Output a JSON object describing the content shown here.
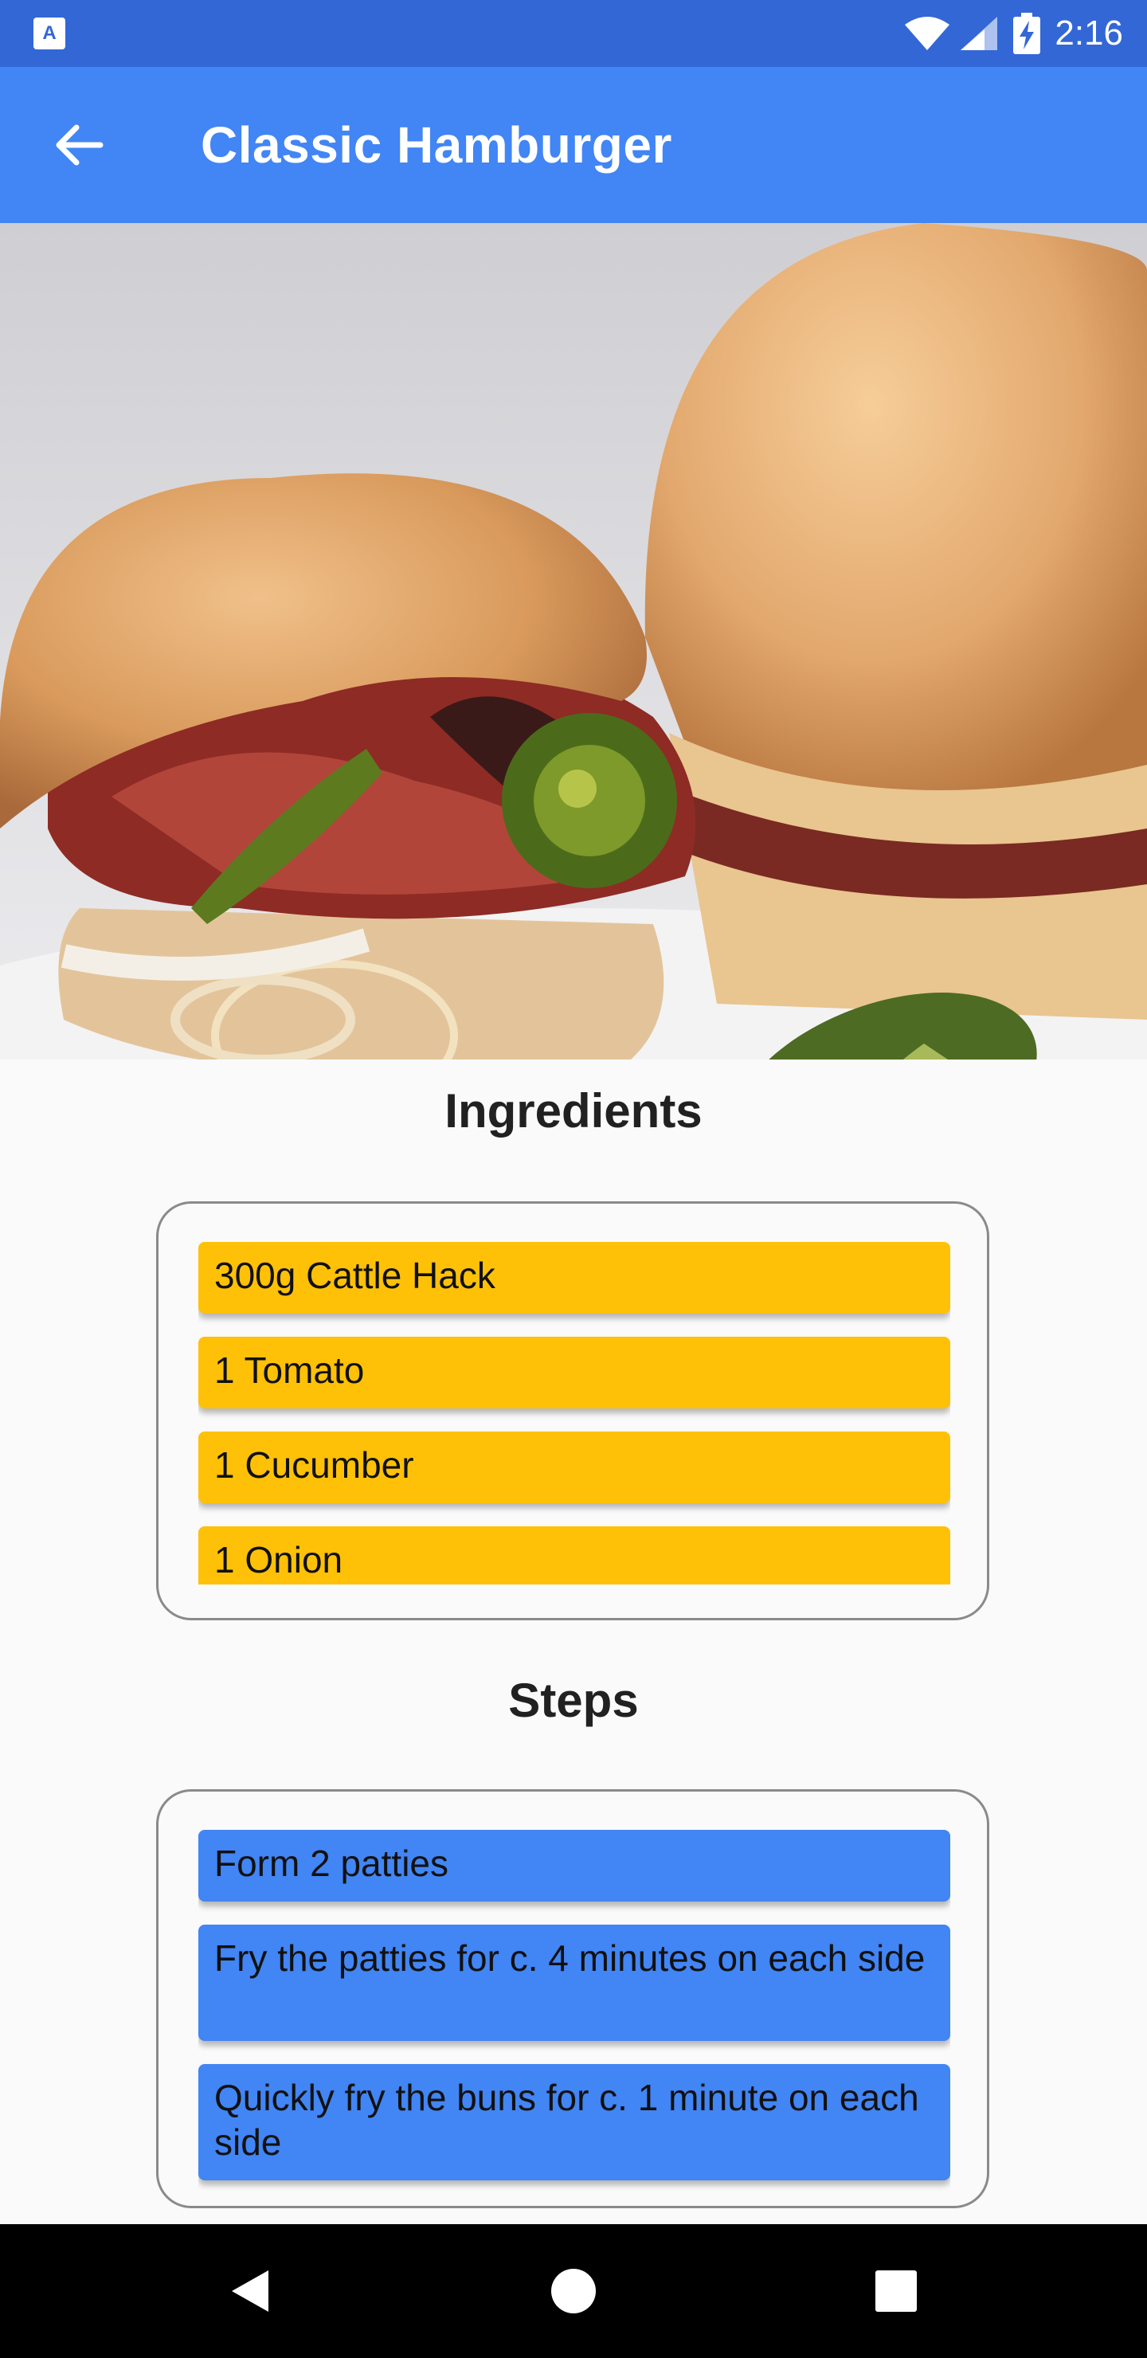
{
  "status_bar": {
    "time": "2:16",
    "icons": [
      "app-notification-icon",
      "wifi-icon",
      "cell-signal-icon",
      "battery-charging-icon"
    ]
  },
  "app_bar": {
    "title": "Classic Hamburger",
    "back_icon": "arrow-back-icon"
  },
  "hero_image": {
    "subject": "burger-photo",
    "colors": {
      "bun": "#e0a86a",
      "bacon": "#8e2b25",
      "pickle": "#6f8a30",
      "plate": "#e6e6e8"
    }
  },
  "ingredients": {
    "title": "Ingredients",
    "items": [
      "300g Cattle Hack",
      "1 Tomato",
      "1 Cucumber",
      "1 Onion"
    ]
  },
  "steps": {
    "title": "Steps",
    "items": [
      "Form 2 patties",
      "Fry the patties for c. 4 minutes on each side",
      "Quickly fry the buns for c. 1 minute on each side"
    ]
  },
  "nav_bar": {
    "icons": [
      "back-triangle-icon",
      "home-circle-icon",
      "recents-square-icon"
    ]
  },
  "colors": {
    "status_bar": "#3367d6",
    "app_bar": "#4285f4",
    "ingredient_item": "#ffc107",
    "step_item": "#4285f4",
    "background": "#fafafa"
  }
}
